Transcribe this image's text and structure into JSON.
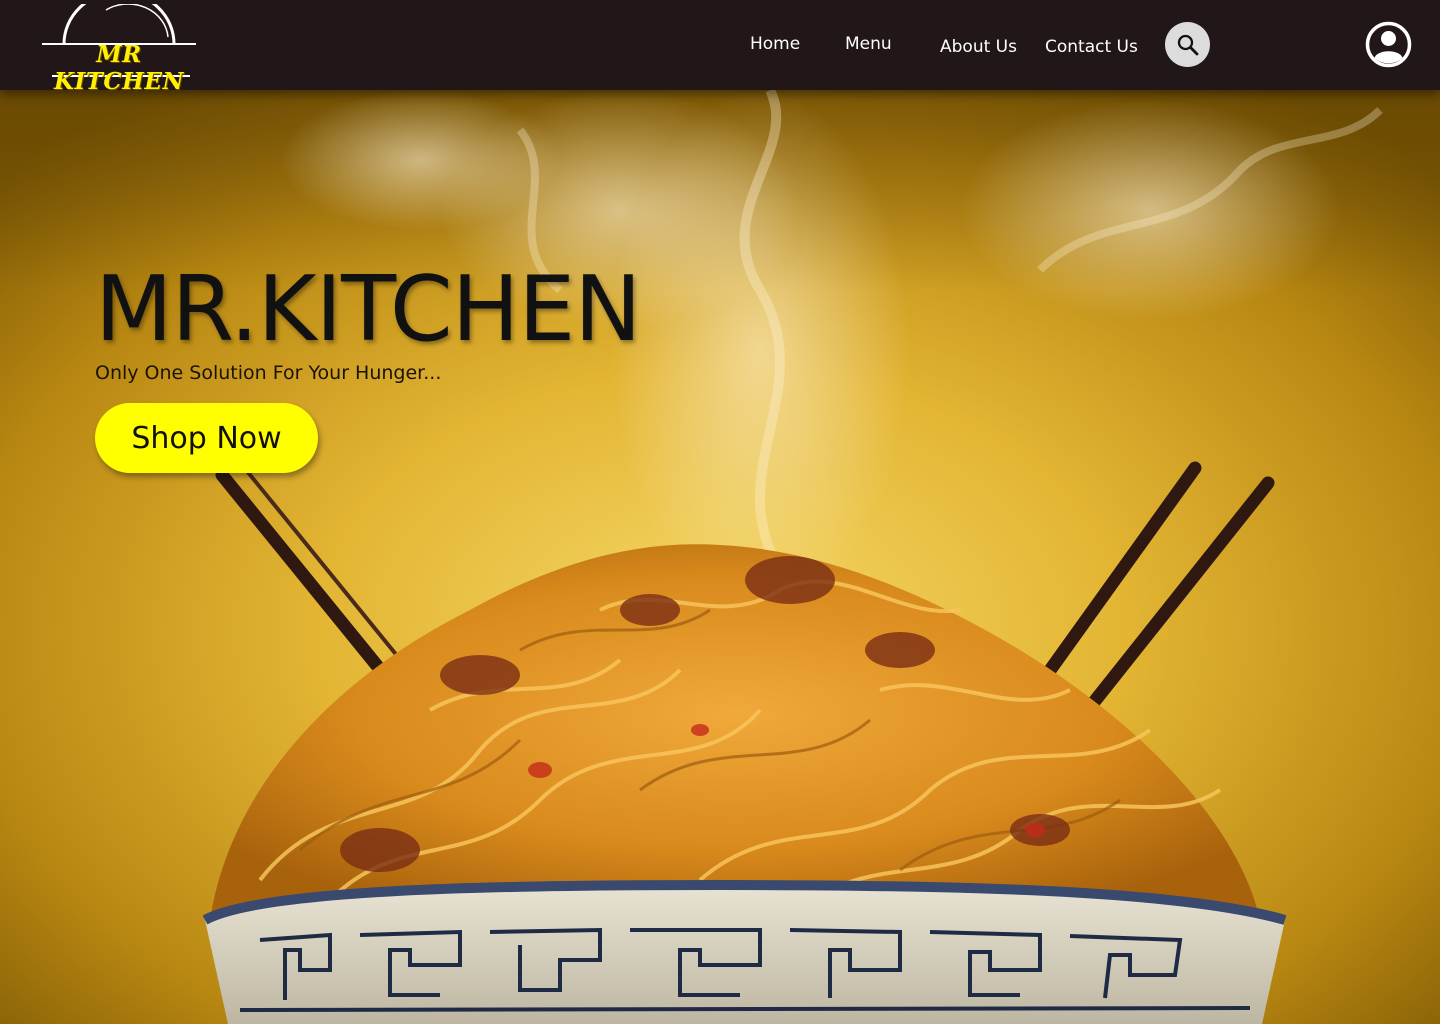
{
  "logo": {
    "text": "MR KITCHEN"
  },
  "nav": {
    "home": "Home",
    "menu": "Menu",
    "about": "About Us",
    "contact": "Contact Us",
    "search_icon": "search-icon",
    "profile_icon": "user-circle-icon"
  },
  "hero": {
    "title": "MR.KITCHEN",
    "tagline": "Only One Solution For Your Hunger...",
    "cta_label": "Shop Now"
  },
  "colors": {
    "navbar_bg": "#211618",
    "cta_bg": "#ffff00",
    "logo_text": "#ffef00",
    "hero_bg": "#e0b22e"
  }
}
